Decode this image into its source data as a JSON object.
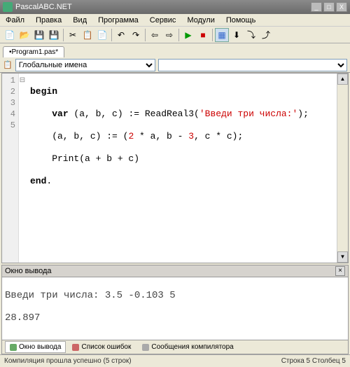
{
  "window": {
    "title": "PascalABC.NET",
    "min": "_",
    "max": "□",
    "close": "X"
  },
  "menu": {
    "items": [
      "Файл",
      "Правка",
      "Вид",
      "Программа",
      "Сервис",
      "Модули",
      "Помощь"
    ]
  },
  "tabs": {
    "file": "•Program1.pas*"
  },
  "scope": {
    "selected": "Глобальные имена"
  },
  "code": {
    "lines": [
      "1",
      "2",
      "3",
      "4",
      "5"
    ],
    "l1_kw": "begin",
    "l2_kw": "var",
    "l2_rest1": " (a, b, c) := ReadReal3(",
    "l2_str": "'Введи три числа:'",
    "l2_rest2": ");",
    "l3_a": "    (a, b, c) := (",
    "l3_n1": "2",
    "l3_b": " * a, b - ",
    "l3_n2": "3",
    "l3_c": ", c * c);",
    "l4": "    Print(a + b + c)",
    "l5_kw": "end",
    "l5_rest": "."
  },
  "output": {
    "title": "Окно вывода",
    "line1": "Введи три числа: 3.5 -0.103 5",
    "line2": "28.897",
    "close": "×"
  },
  "otabs": {
    "t1": "Окно вывода",
    "t2": "Список ошибок",
    "t3": "Сообщения компилятора"
  },
  "status": {
    "left": "Компиляция прошла успешно (5 строк)",
    "right": "Строка  5 Столбец  5"
  },
  "colors": {
    "accent": "#cde"
  }
}
